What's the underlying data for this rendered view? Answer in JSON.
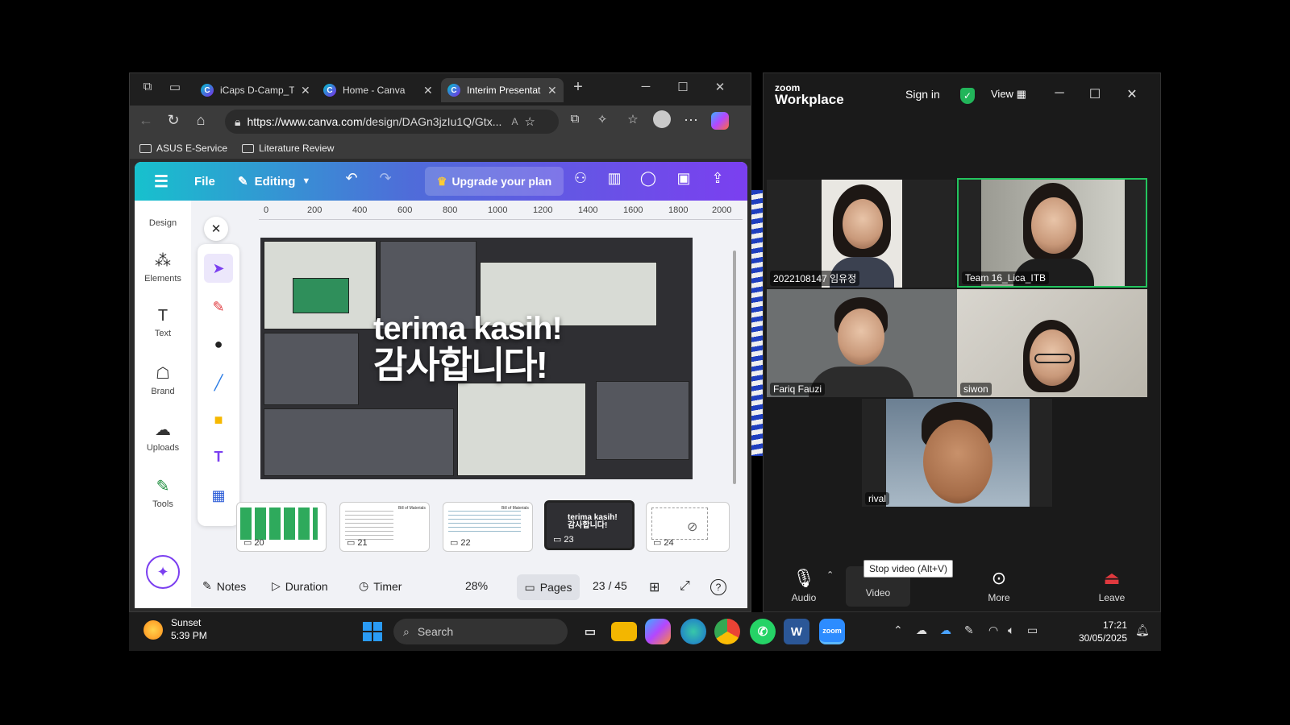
{
  "browser": {
    "tabs": [
      {
        "title": "iCaps D-Camp_Te",
        "active": false
      },
      {
        "title": "Home - Canva",
        "active": false
      },
      {
        "title": "Interim Presentati",
        "active": true
      }
    ],
    "url_host": "https://www.canva.com",
    "url_path": "/design/DAGn3jzIu1Q/Gtx...",
    "bookmarks": [
      "ASUS E-Service",
      "Literature Review"
    ]
  },
  "canva": {
    "menu_file": "File",
    "mode": "Editing",
    "upgrade": "Upgrade your plan",
    "rail": [
      {
        "label": "Design",
        "icon": "design-icon"
      },
      {
        "label": "Elements",
        "icon": "elements-icon"
      },
      {
        "label": "Text",
        "icon": "text-icon"
      },
      {
        "label": "Brand",
        "icon": "brand-icon"
      },
      {
        "label": "Uploads",
        "icon": "uploads-icon"
      },
      {
        "label": "Tools",
        "icon": "tools-icon"
      }
    ],
    "ruler": [
      "0",
      "200",
      "400",
      "600",
      "800",
      "1000",
      "1200",
      "1400",
      "1600",
      "1800",
      "2000"
    ],
    "slide": {
      "line1": "terima kasih!",
      "line2": "감사합니다!"
    },
    "thumbs": [
      {
        "num": "20"
      },
      {
        "num": "21",
        "caption": "Bill of Materials"
      },
      {
        "num": "22",
        "caption": "Bill of Materials"
      },
      {
        "num": "23",
        "line1": "terima kasih!",
        "line2": "감사합니다!"
      },
      {
        "num": "24"
      }
    ],
    "bottom": {
      "notes": "Notes",
      "duration": "Duration",
      "timer": "Timer",
      "zoom": "28%",
      "pages": "Pages",
      "page_count": "23 / 45"
    }
  },
  "zoom": {
    "brand_top": "zoom",
    "brand_bottom": "Workplace",
    "sign_in": "Sign in",
    "view": "View",
    "participants": [
      "2022108147 임유정",
      "Team 16_Lica_ITB",
      "Fariq Fauzi",
      "siwon",
      "rival"
    ],
    "controls": {
      "audio": "Audio",
      "video": "Video",
      "more": "More",
      "leave": "Leave"
    },
    "tooltip": "Stop video (Alt+V)",
    "colors": {
      "active_speaker": "#23c45e",
      "leave": "#e0393e"
    }
  },
  "taskbar": {
    "weather_title": "Sunset",
    "weather_time": "5:39 PM",
    "search": "Search",
    "time": "17:21",
    "date": "30/05/2025"
  }
}
